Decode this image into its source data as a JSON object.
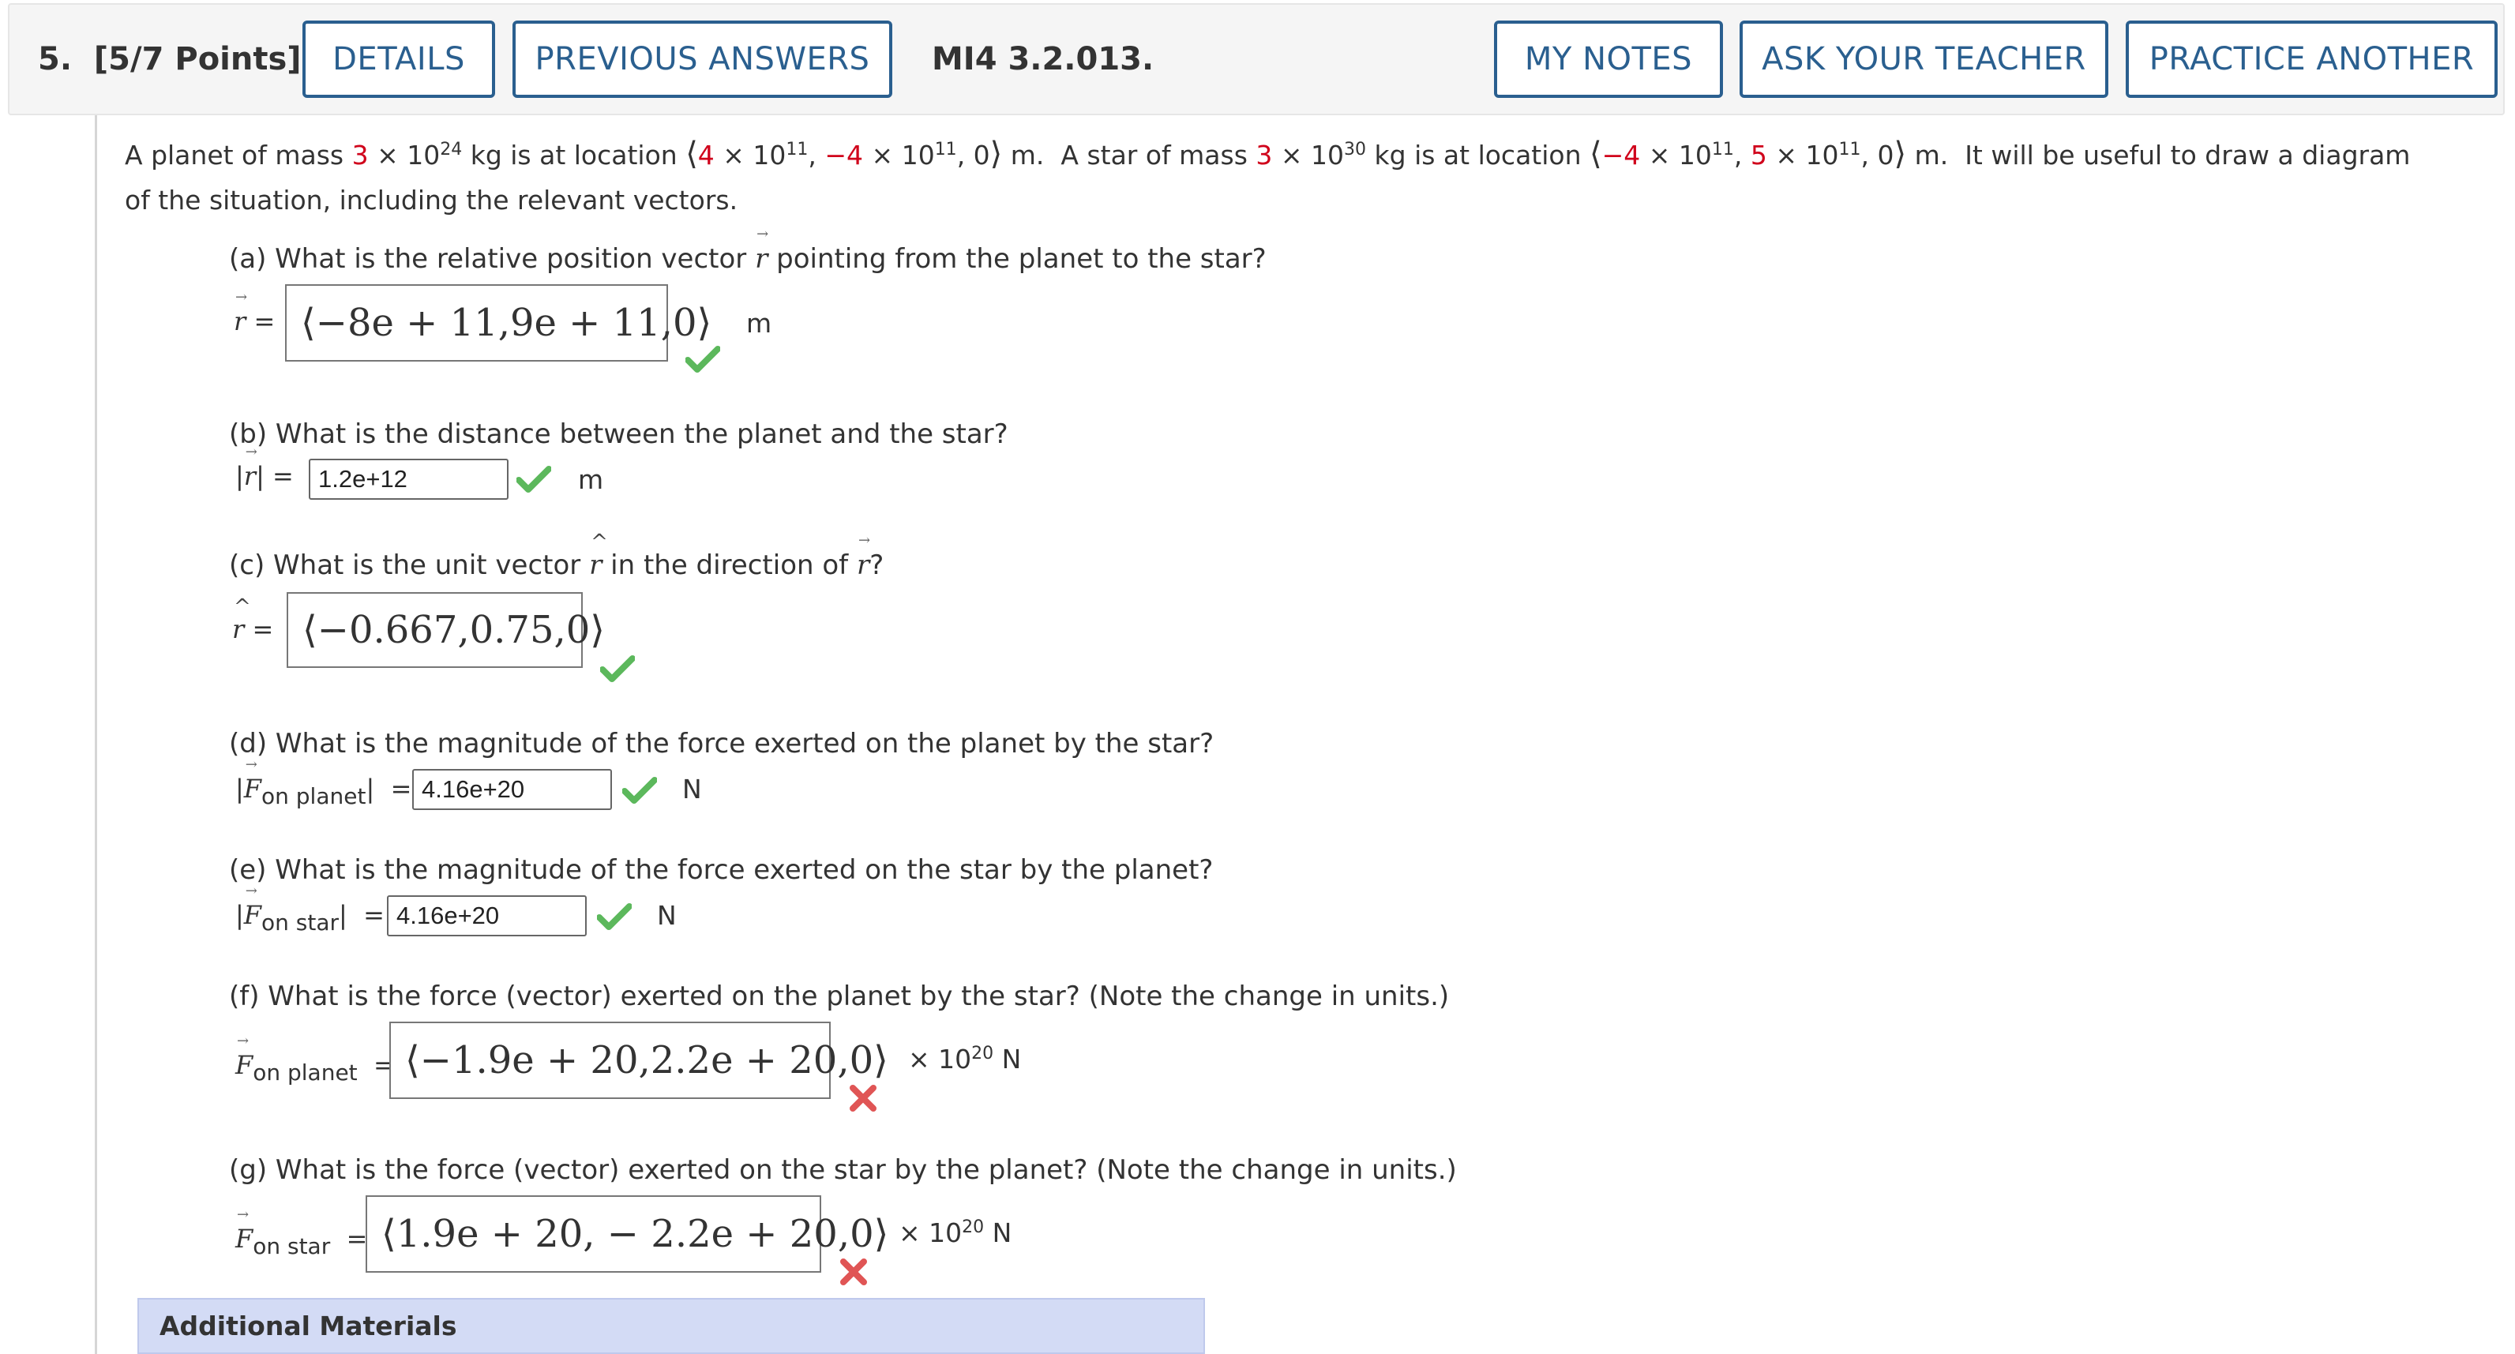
{
  "header": {
    "question_number": "5.",
    "points": "[5/7 Points]",
    "details_label": "DETAILS",
    "previous_answers_label": "PREVIOUS ANSWERS",
    "question_id": "MI4 3.2.013.",
    "my_notes_label": "MY NOTES",
    "ask_teacher_label": "ASK YOUR TEACHER",
    "practice_another_label": "PRACTICE ANOTHER"
  },
  "problem": {
    "planet_mass_coef": "3",
    "planet_mass_exp": "24",
    "planet_x_coef": "4",
    "planet_y_coef": "−4",
    "planet_pos_exp": "11",
    "star_mass_coef": "3",
    "star_mass_exp": "30",
    "star_x_coef": "−4",
    "star_y_coef": "5",
    "star_pos_exp": "11",
    "line2": "of the situation, including the relevant vectors."
  },
  "parts": {
    "a": {
      "question_pre": "(a) What is the relative position vector ",
      "question_post": " pointing from the planet to the star?",
      "answer": "⟨−8e + 11,9e + 11,0⟩",
      "unit": "m",
      "status": "correct"
    },
    "b": {
      "question": "(b) What is the distance between the planet and the star?",
      "answer": "1.2e+12",
      "unit": "m",
      "status": "correct"
    },
    "c": {
      "question_pre": "(c) What is the unit vector ",
      "question_mid": " in the direction of ",
      "question_post": "?",
      "answer": "⟨−0.667,0.75,0⟩",
      "status": "correct"
    },
    "d": {
      "question": "(d) What is the magnitude of the force exerted on the planet by the star?",
      "subscript": "on planet",
      "answer": "4.16e+20",
      "unit": "N",
      "status": "correct"
    },
    "e": {
      "question": "(e) What is the magnitude of the force exerted on the star by the planet?",
      "subscript": "on star",
      "answer": "4.16e+20",
      "unit": "N",
      "status": "correct"
    },
    "f": {
      "question": "(f) What is the force (vector) exerted on the planet by the star? (Note the change in units.)",
      "subscript": "on planet",
      "answer": "⟨−1.9e + 20,2.2e + 20,0⟩",
      "unit_exp": "20",
      "status": "incorrect"
    },
    "g": {
      "question": "(g) What is the force (vector) exerted on the star by the planet? (Note the change in units.)",
      "subscript": "on star",
      "answer": "⟨1.9e + 20, − 2.2e + 20,0⟩",
      "unit_exp": "20",
      "status": "incorrect"
    }
  },
  "additional_materials_label": "Additional Materials",
  "colors": {
    "button_blue": "#2a5f8f",
    "correct_green": "#5cb85c",
    "incorrect_red": "#e05555",
    "given_red": "#d0021b"
  }
}
